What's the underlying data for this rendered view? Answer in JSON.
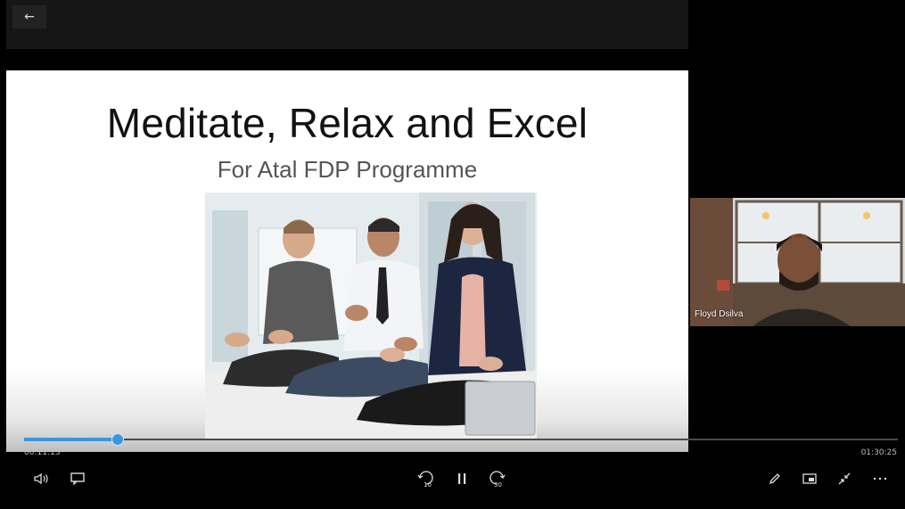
{
  "player": {
    "back_icon": "arrow-left-icon",
    "elapsed": "00:11:13",
    "duration": "01:30:25",
    "progress_fraction": 0.107,
    "accent_color": "#3a96dd"
  },
  "slide": {
    "title": "Meditate, Relax and Excel",
    "subtitle": "For Atal FDP Programme"
  },
  "webcam": {
    "participant_name": "Floyd Dsilva"
  },
  "controls": {
    "left": [
      "volume-icon",
      "captions-icon"
    ],
    "center": [
      "skip-back-10-icon",
      "pause-icon",
      "skip-forward-30-icon"
    ],
    "skip_back_label": "10",
    "skip_forward_label": "30",
    "right": [
      "pen-icon",
      "mini-view-icon",
      "exit-fullscreen-icon",
      "more-options-icon"
    ]
  }
}
